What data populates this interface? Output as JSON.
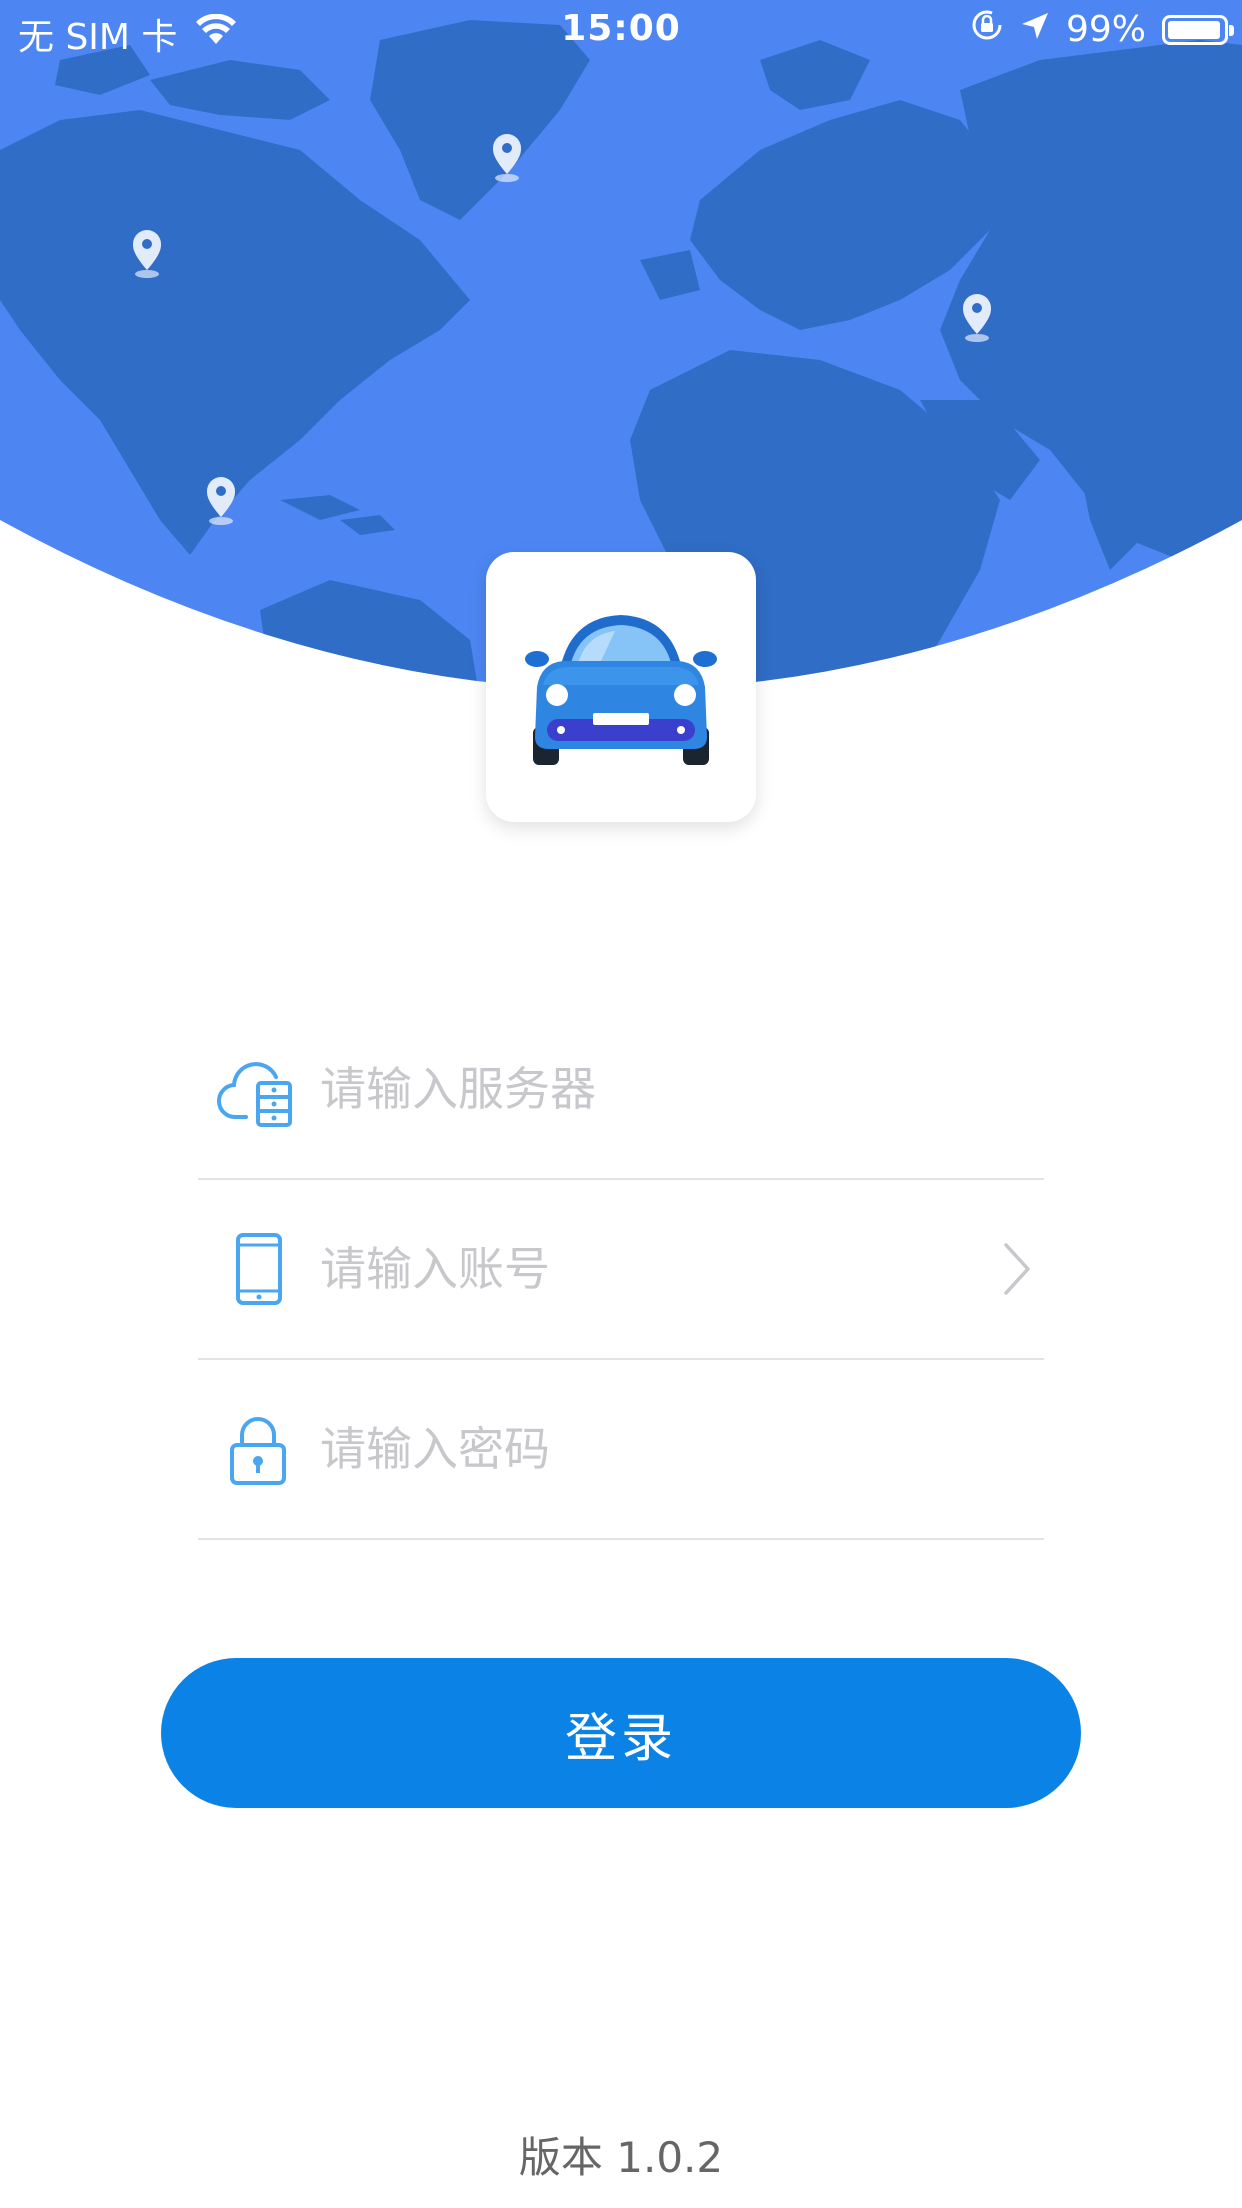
{
  "status_bar": {
    "carrier": "无 SIM 卡",
    "time": "15:00",
    "battery_percent": "99%",
    "battery_level": 0.99,
    "icons": [
      "wifi-icon",
      "orientation-lock-icon",
      "location-arrow-icon",
      "battery-icon"
    ]
  },
  "header": {
    "background": "world-map",
    "colors": {
      "ocean": "#4d86f2",
      "land": "#306dc6"
    },
    "markers": [
      "map-pin-icon",
      "map-pin-icon",
      "map-pin-icon",
      "map-pin-icon"
    ]
  },
  "logo": {
    "icon": "car-icon"
  },
  "form": {
    "server": {
      "icon": "cloud-server-icon",
      "placeholder": "请输入服务器",
      "value": ""
    },
    "account": {
      "icon": "phone-icon",
      "placeholder": "请输入账号",
      "value": "",
      "trailing_icon": "chevron-right-icon"
    },
    "password": {
      "icon": "lock-icon",
      "placeholder": "请输入密码",
      "value": ""
    }
  },
  "login_button": {
    "label": "登录",
    "color": "#0a82e6"
  },
  "version": {
    "text": "版本 1.0.2"
  }
}
